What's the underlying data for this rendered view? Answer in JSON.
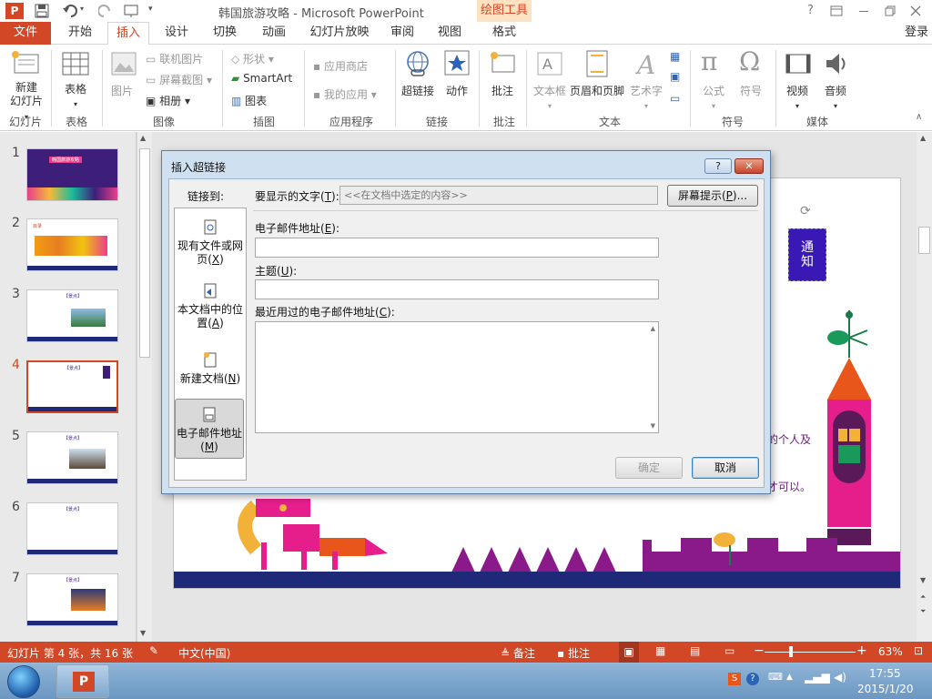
{
  "titlebar": {
    "app_icon": "P",
    "title": "韩国旅游攻略 - Microsoft PowerPoint",
    "context_tab_group": "绘图工具",
    "help": "?",
    "window_controls": [
      "ribbon-display-icon",
      "minimize-icon",
      "restore-icon",
      "close-icon"
    ]
  },
  "tabs": {
    "file": "文件",
    "items": [
      "开始",
      "插入",
      "设计",
      "切换",
      "动画",
      "幻灯片放映",
      "审阅",
      "视图",
      "格式"
    ],
    "active": "插入",
    "login": "登录"
  },
  "ribbon": {
    "groups": [
      {
        "label": "幻灯片",
        "items": [
          "新建",
          "幻灯片"
        ]
      },
      {
        "label": "表格",
        "items": [
          "表格"
        ]
      },
      {
        "label": "图像",
        "items": [
          "图片",
          "联机图片",
          "屏幕截图",
          "相册"
        ]
      },
      {
        "label": "插图",
        "items": [
          "形状",
          "SmartArt",
          "图表"
        ]
      },
      {
        "label": "应用程序",
        "items": [
          "应用商店",
          "我的应用"
        ]
      },
      {
        "label": "链接",
        "items": [
          "超链接",
          "动作"
        ]
      },
      {
        "label": "批注",
        "items": [
          "批注"
        ]
      },
      {
        "label": "文本",
        "items": [
          "文本框",
          "页眉和页脚",
          "艺术字"
        ]
      },
      {
        "label": "符号",
        "items": [
          "公式",
          "符号"
        ]
      },
      {
        "label": "媒体",
        "items": [
          "视频",
          "音频"
        ]
      }
    ]
  },
  "thumbnails": {
    "numbers": [
      "1",
      "2",
      "3",
      "4",
      "5",
      "6",
      "7"
    ],
    "selected": "4",
    "titles": [
      "韩国旅游攻略",
      "目录",
      "【景点】",
      "【景点】",
      "【景点】",
      "【景点】",
      "【景点】"
    ]
  },
  "slide": {
    "badge_text": "通\n知",
    "visible_text_1": "下的个人及",
    "visible_text_2": "后才可以。"
  },
  "dialog": {
    "title": "插入超链接",
    "help_btn": "?",
    "close_btn": "✕",
    "link_to_label": "链接到:",
    "display_text_label": "要显示的文字(",
    "display_text_key": "T",
    "display_text_label_end": "):",
    "display_text_value": "<<在文档中选定的内容>>",
    "screentip_btn": "屏幕提示(",
    "screentip_key": "P",
    "screentip_end": ")...",
    "email_label": "电子邮件地址(",
    "email_key": "E",
    "email_label_end": "):",
    "email_value": "",
    "subject_label": "主题(",
    "subject_key": "U",
    "subject_label_end": "):",
    "subject_value": "",
    "recent_label": "最近用过的电子邮件地址(",
    "recent_key": "C",
    "recent_label_end": "):",
    "link_options": [
      {
        "line1": "现有文件或网",
        "line2": "页(",
        "key": "X",
        "end": ")"
      },
      {
        "line1": "本文档中的位",
        "line2": "置(",
        "key": "A",
        "end": ")"
      },
      {
        "line1": "新建文档(",
        "line2": "",
        "key": "N",
        "end": ")"
      },
      {
        "line1": "电子邮件地址",
        "line2": "(",
        "key": "M",
        "end": ")"
      }
    ],
    "ok_btn": "确定",
    "cancel_btn": "取消"
  },
  "status": {
    "slide_info": "幻灯片 第 4 张，共 16 张",
    "language": "中文(中国)",
    "notes": "备注",
    "comments": "批注",
    "zoom": "63%"
  },
  "taskbar": {
    "time": "17:55",
    "date": "2015/1/20"
  },
  "colors": {
    "accent": "#d24726",
    "dialog_frame": "#cfe0f1"
  }
}
